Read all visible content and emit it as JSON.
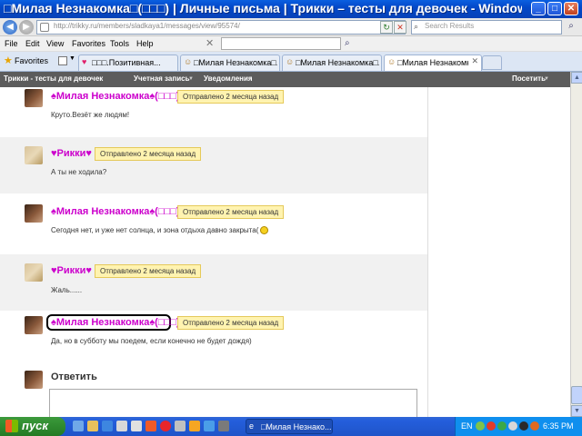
{
  "window": {
    "title": "□Милая Незнакомка□(□□□) | Личные письма | Трикки – тесты для девочек - Windows Internet E...",
    "min": "_",
    "max": "□",
    "close": "✕"
  },
  "address": {
    "url": "http://trikky.ru/members/sladkaya1/messages/view/95574/",
    "search_placeholder": "Search Results"
  },
  "menu": [
    "File",
    "Edit",
    "View",
    "Favorites",
    "Tools",
    "Help"
  ],
  "favorites": {
    "label": "Favorites"
  },
  "tabs": [
    {
      "label": "□□□.Позитивная..."
    },
    {
      "label": "□Милая Незнакомка□..."
    },
    {
      "label": "□Милая Незнакомка□..."
    },
    {
      "label": "□Милая Незнакомка□..."
    }
  ],
  "sitebar": {
    "brand": "Трикки - тесты для девочек",
    "account": "Учетная запись",
    "notifications": "Уведомления",
    "visit": "Посетить"
  },
  "messages": [
    {
      "author": "♠Милая Незнакомка♠(□□□)",
      "sent": "Отправлено 2 месяца назад",
      "text": "Круто.Везёт же людям!"
    },
    {
      "author": "♥Рикки♥",
      "sent": "Отправлено 2 месяца назад",
      "text": "А ты не ходила?"
    },
    {
      "author": "♠Милая Незнакомка♠(□□□)",
      "sent": "Отправлено 2 месяца назад",
      "text": "Сегодня нет, и уже нет солнца, и зона отдыха давно закрыта("
    },
    {
      "author": "♥Рикки♥",
      "sent": "Отправлено 2 месяца назад",
      "text": "Жаль......"
    },
    {
      "author": "♠Милая Незнакомка♠(□□□)",
      "sent": "Отправлено 2 месяца назад",
      "text": "Да, но в субботу мы поедем, если конечно не будет дождя)"
    }
  ],
  "reply": {
    "title": "Ответить"
  },
  "taskbar": {
    "start": "пуск",
    "window_button": "□Милая Незнако...",
    "lang": "EN",
    "clock": "6:35 PM"
  },
  "colors": {
    "author": "#CC00CC",
    "badge_bg": "#FFF3B0",
    "sitebar": "#5C5C5C"
  }
}
